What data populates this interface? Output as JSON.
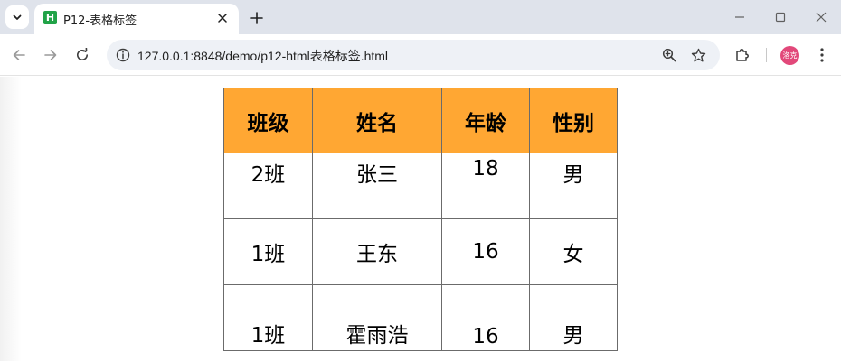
{
  "browser": {
    "tab": {
      "title": "P12-表格标签",
      "favicon_letter": "H"
    },
    "address": {
      "url": "127.0.0.1:8848/demo/p12-html表格标签.html"
    },
    "profile": {
      "avatar_text": "洛克",
      "color": "#e2487a"
    },
    "colors": {
      "tabstrip": "#dfe3eb",
      "omnibox": "#eef1f6",
      "favicon": "#21a348"
    }
  },
  "page": {
    "table": {
      "header_bg": "#ffa733",
      "headers": [
        "班级",
        "姓名",
        "年龄",
        "性别"
      ],
      "rows": [
        [
          "2班",
          "张三",
          "18",
          "男"
        ],
        [
          "1班",
          "王东",
          "16",
          "女"
        ],
        [
          "1班",
          "霍雨浩",
          "16",
          "男"
        ]
      ]
    }
  }
}
